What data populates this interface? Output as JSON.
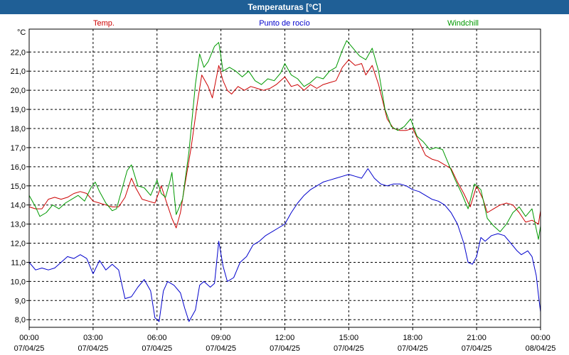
{
  "window": {
    "title": "Temperaturas [°C]"
  },
  "chart_data": {
    "type": "line",
    "title": "Temperaturas [°C]",
    "ylabel": "°C",
    "ylim": [
      7.6,
      23.2
    ],
    "yticks": [
      8,
      9,
      10,
      11,
      12,
      13,
      14,
      15,
      16,
      17,
      18,
      19,
      20,
      21,
      22
    ],
    "ytick_labels": [
      "8,0",
      "9,0",
      "10,0",
      "11,0",
      "12,0",
      "13,0",
      "14,0",
      "15,0",
      "16,0",
      "17,0",
      "18,0",
      "19,0",
      "20,0",
      "21,0",
      "22,0"
    ],
    "xlim": [
      0,
      24
    ],
    "xticks": [
      {
        "time": "00:00",
        "date": "07/04/25"
      },
      {
        "time": "03:00",
        "date": "07/04/25"
      },
      {
        "time": "06:00",
        "date": "07/04/25"
      },
      {
        "time": "09:00",
        "date": "07/04/25"
      },
      {
        "time": "12:00",
        "date": "07/04/25"
      },
      {
        "time": "15:00",
        "date": "07/04/25"
      },
      {
        "time": "18:00",
        "date": "07/04/25"
      },
      {
        "time": "21:00",
        "date": "07/04/25"
      },
      {
        "time": "00:00",
        "date": "08/04/25"
      }
    ],
    "grid": true,
    "legend_position": "top",
    "series": [
      {
        "name": "Temp.",
        "color": "#cc0000",
        "points": [
          [
            0,
            13.9
          ],
          [
            0.3,
            13.8
          ],
          [
            0.6,
            13.8
          ],
          [
            0.9,
            14.3
          ],
          [
            1.2,
            14.4
          ],
          [
            1.5,
            14.3
          ],
          [
            1.8,
            14.4
          ],
          [
            2.1,
            14.6
          ],
          [
            2.4,
            14.7
          ],
          [
            2.7,
            14.6
          ],
          [
            3.0,
            14.2
          ],
          [
            3.3,
            14.1
          ],
          [
            3.6,
            14.0
          ],
          [
            3.9,
            13.9
          ],
          [
            4.2,
            13.9
          ],
          [
            4.5,
            14.4
          ],
          [
            4.8,
            15.4
          ],
          [
            5.0,
            14.9
          ],
          [
            5.3,
            14.3
          ],
          [
            5.6,
            14.2
          ],
          [
            5.9,
            14.1
          ],
          [
            6.0,
            14.4
          ],
          [
            6.2,
            15.0
          ],
          [
            6.4,
            14.3
          ],
          [
            6.7,
            13.3
          ],
          [
            6.9,
            12.8
          ],
          [
            7.1,
            13.6
          ],
          [
            7.3,
            15.0
          ],
          [
            7.6,
            17.0
          ],
          [
            7.9,
            19.4
          ],
          [
            8.1,
            20.8
          ],
          [
            8.4,
            20.2
          ],
          [
            8.6,
            19.6
          ],
          [
            8.9,
            21.3
          ],
          [
            9.1,
            20.5
          ],
          [
            9.3,
            20.0
          ],
          [
            9.5,
            19.8
          ],
          [
            9.8,
            20.2
          ],
          [
            10.1,
            20.0
          ],
          [
            10.4,
            20.2
          ],
          [
            10.7,
            20.1
          ],
          [
            11.0,
            20.0
          ],
          [
            11.3,
            20.1
          ],
          [
            11.6,
            20.3
          ],
          [
            12.0,
            20.7
          ],
          [
            12.3,
            20.2
          ],
          [
            12.6,
            20.3
          ],
          [
            12.9,
            20.0
          ],
          [
            13.2,
            20.3
          ],
          [
            13.5,
            20.1
          ],
          [
            13.8,
            20.3
          ],
          [
            14.1,
            20.4
          ],
          [
            14.4,
            20.5
          ],
          [
            14.7,
            21.2
          ],
          [
            15.0,
            21.6
          ],
          [
            15.3,
            21.3
          ],
          [
            15.6,
            21.4
          ],
          [
            15.8,
            20.8
          ],
          [
            16.1,
            21.3
          ],
          [
            16.4,
            20.3
          ],
          [
            16.8,
            18.5
          ],
          [
            17.1,
            18.0
          ],
          [
            17.4,
            17.9
          ],
          [
            17.7,
            17.9
          ],
          [
            18.0,
            18.0
          ],
          [
            18.3,
            17.3
          ],
          [
            18.6,
            16.6
          ],
          [
            18.9,
            16.4
          ],
          [
            19.2,
            16.3
          ],
          [
            19.5,
            16.1
          ],
          [
            19.8,
            15.9
          ],
          [
            20.1,
            15.2
          ],
          [
            20.4,
            14.6
          ],
          [
            20.7,
            13.9
          ],
          [
            21.0,
            15.0
          ],
          [
            21.3,
            14.3
          ],
          [
            21.5,
            13.6
          ],
          [
            21.8,
            13.8
          ],
          [
            22.1,
            14.0
          ],
          [
            22.4,
            14.1
          ],
          [
            22.7,
            14.0
          ],
          [
            23.0,
            13.6
          ],
          [
            23.3,
            13.1
          ],
          [
            23.6,
            13.2
          ],
          [
            23.9,
            13.0
          ],
          [
            24.0,
            13.7
          ]
        ]
      },
      {
        "name": "Punto de rocío",
        "color": "#0000cc",
        "points": [
          [
            0,
            11.0
          ],
          [
            0.3,
            10.6
          ],
          [
            0.6,
            10.7
          ],
          [
            0.9,
            10.6
          ],
          [
            1.2,
            10.7
          ],
          [
            1.5,
            11.0
          ],
          [
            1.8,
            11.3
          ],
          [
            2.1,
            11.2
          ],
          [
            2.4,
            11.4
          ],
          [
            2.7,
            11.2
          ],
          [
            3.0,
            10.4
          ],
          [
            3.3,
            11.1
          ],
          [
            3.6,
            10.6
          ],
          [
            3.9,
            10.9
          ],
          [
            4.2,
            10.6
          ],
          [
            4.5,
            9.1
          ],
          [
            4.8,
            9.2
          ],
          [
            5.1,
            9.7
          ],
          [
            5.4,
            10.1
          ],
          [
            5.7,
            9.5
          ],
          [
            5.9,
            8.1
          ],
          [
            6.1,
            7.9
          ],
          [
            6.3,
            9.5
          ],
          [
            6.5,
            10.0
          ],
          [
            6.8,
            9.8
          ],
          [
            7.1,
            9.4
          ],
          [
            7.3,
            8.6
          ],
          [
            7.5,
            7.9
          ],
          [
            7.8,
            8.5
          ],
          [
            8.0,
            9.8
          ],
          [
            8.2,
            10.0
          ],
          [
            8.5,
            9.7
          ],
          [
            8.7,
            9.9
          ],
          [
            8.9,
            12.1
          ],
          [
            9.1,
            10.8
          ],
          [
            9.3,
            10.0
          ],
          [
            9.6,
            10.2
          ],
          [
            9.9,
            11.0
          ],
          [
            10.2,
            11.3
          ],
          [
            10.5,
            11.9
          ],
          [
            10.8,
            12.1
          ],
          [
            11.1,
            12.4
          ],
          [
            11.4,
            12.6
          ],
          [
            11.7,
            12.8
          ],
          [
            12.0,
            13.0
          ],
          [
            12.3,
            13.6
          ],
          [
            12.6,
            14.1
          ],
          [
            12.9,
            14.5
          ],
          [
            13.2,
            14.8
          ],
          [
            13.5,
            15.0
          ],
          [
            13.8,
            15.2
          ],
          [
            14.1,
            15.3
          ],
          [
            14.4,
            15.4
          ],
          [
            14.7,
            15.5
          ],
          [
            15.0,
            15.6
          ],
          [
            15.3,
            15.5
          ],
          [
            15.6,
            15.4
          ],
          [
            15.9,
            15.9
          ],
          [
            16.2,
            15.4
          ],
          [
            16.5,
            15.1
          ],
          [
            16.8,
            15.0
          ],
          [
            17.1,
            15.1
          ],
          [
            17.4,
            15.1
          ],
          [
            17.7,
            15.0
          ],
          [
            18.0,
            14.8
          ],
          [
            18.3,
            14.7
          ],
          [
            18.6,
            14.5
          ],
          [
            18.9,
            14.3
          ],
          [
            19.2,
            14.2
          ],
          [
            19.5,
            14.0
          ],
          [
            19.8,
            13.6
          ],
          [
            20.1,
            13.0
          ],
          [
            20.4,
            12.0
          ],
          [
            20.6,
            11.0
          ],
          [
            20.8,
            10.9
          ],
          [
            21.0,
            11.3
          ],
          [
            21.2,
            12.3
          ],
          [
            21.4,
            12.1
          ],
          [
            21.7,
            12.4
          ],
          [
            22.0,
            12.5
          ],
          [
            22.3,
            12.4
          ],
          [
            22.6,
            12.0
          ],
          [
            22.9,
            11.6
          ],
          [
            23.1,
            11.4
          ],
          [
            23.4,
            11.6
          ],
          [
            23.6,
            11.3
          ],
          [
            23.8,
            10.3
          ],
          [
            23.9,
            9.3
          ],
          [
            24.0,
            8.4
          ]
        ]
      },
      {
        "name": "Windchill",
        "color": "#009900",
        "points": [
          [
            0,
            14.5
          ],
          [
            0.3,
            13.9
          ],
          [
            0.5,
            13.4
          ],
          [
            0.8,
            13.6
          ],
          [
            1.1,
            14.0
          ],
          [
            1.4,
            13.8
          ],
          [
            1.7,
            14.1
          ],
          [
            2.0,
            14.3
          ],
          [
            2.3,
            14.5
          ],
          [
            2.6,
            14.2
          ],
          [
            2.9,
            14.9
          ],
          [
            3.1,
            15.2
          ],
          [
            3.3,
            14.7
          ],
          [
            3.6,
            14.1
          ],
          [
            3.9,
            13.7
          ],
          [
            4.1,
            13.8
          ],
          [
            4.4,
            15.0
          ],
          [
            4.6,
            15.8
          ],
          [
            4.8,
            16.1
          ],
          [
            5.1,
            15.0
          ],
          [
            5.4,
            14.9
          ],
          [
            5.7,
            14.5
          ],
          [
            6.0,
            15.3
          ],
          [
            6.2,
            14.6
          ],
          [
            6.4,
            14.4
          ],
          [
            6.6,
            15.2
          ],
          [
            6.7,
            15.7
          ],
          [
            6.9,
            13.5
          ],
          [
            7.2,
            14.3
          ],
          [
            7.5,
            16.8
          ],
          [
            7.8,
            20.3
          ],
          [
            8.0,
            21.9
          ],
          [
            8.2,
            21.2
          ],
          [
            8.4,
            21.5
          ],
          [
            8.7,
            22.3
          ],
          [
            8.9,
            22.5
          ],
          [
            9.1,
            21.0
          ],
          [
            9.4,
            21.2
          ],
          [
            9.7,
            21.0
          ],
          [
            10.0,
            20.7
          ],
          [
            10.3,
            21.0
          ],
          [
            10.6,
            20.5
          ],
          [
            10.9,
            20.3
          ],
          [
            11.2,
            20.6
          ],
          [
            11.5,
            20.5
          ],
          [
            11.8,
            20.9
          ],
          [
            12.0,
            21.4
          ],
          [
            12.3,
            20.8
          ],
          [
            12.6,
            20.6
          ],
          [
            12.9,
            20.2
          ],
          [
            13.2,
            20.4
          ],
          [
            13.5,
            20.7
          ],
          [
            13.8,
            20.6
          ],
          [
            14.1,
            21.0
          ],
          [
            14.4,
            21.2
          ],
          [
            14.7,
            22.1
          ],
          [
            14.9,
            22.6
          ],
          [
            15.2,
            22.2
          ],
          [
            15.5,
            21.8
          ],
          [
            15.8,
            21.6
          ],
          [
            16.1,
            22.2
          ],
          [
            16.4,
            21.0
          ],
          [
            16.7,
            19.0
          ],
          [
            17.0,
            18.1
          ],
          [
            17.3,
            17.9
          ],
          [
            17.6,
            18.1
          ],
          [
            17.9,
            18.5
          ],
          [
            18.2,
            17.6
          ],
          [
            18.5,
            17.3
          ],
          [
            18.8,
            16.9
          ],
          [
            19.1,
            17.0
          ],
          [
            19.4,
            16.9
          ],
          [
            19.7,
            16.1
          ],
          [
            20.0,
            15.3
          ],
          [
            20.3,
            14.6
          ],
          [
            20.6,
            13.8
          ],
          [
            20.9,
            15.1
          ],
          [
            21.2,
            14.8
          ],
          [
            21.5,
            13.3
          ],
          [
            21.8,
            12.9
          ],
          [
            22.1,
            12.6
          ],
          [
            22.4,
            13.0
          ],
          [
            22.7,
            13.6
          ],
          [
            23.0,
            13.9
          ],
          [
            23.3,
            13.4
          ],
          [
            23.6,
            13.8
          ],
          [
            23.9,
            12.2
          ],
          [
            24.0,
            12.9
          ]
        ]
      }
    ]
  }
}
